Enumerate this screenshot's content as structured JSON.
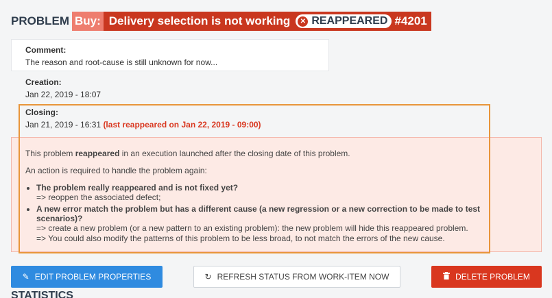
{
  "header": {
    "problem_word": "PROBLEM",
    "buy_tag": "Buy:",
    "title": "Delivery selection is not working",
    "status": "REAPPEARED",
    "ticket": "#4201"
  },
  "comment": {
    "label": "Comment:",
    "text": "The reason and root-cause is still unknown for now..."
  },
  "creation": {
    "label": "Creation:",
    "date": "Jan 22, 2019 - 18:07"
  },
  "closing": {
    "label": "Closing:",
    "date": "Jan 21, 2019 - 16:31",
    "reappeared": "(last reappeared on Jan 22, 2019 - 09:00)"
  },
  "warning": {
    "line1_prefix": "This problem ",
    "line1_bold": "reappeared",
    "line1_suffix": " in an execution launched after the closing date of this problem.",
    "line2": "An action is required to handle the problem again:",
    "item1_title": "The problem really reappeared and is not fixed yet?",
    "item1_sub": "=> reoppen the associated defect;",
    "item2_title": "A new error match the problem but has a different cause (a new regression or a new correction to be made to test scenarios)?",
    "item2_sub1": "=> create a new problem (or a new pattern to an existing problem): the new problem will hide this reappeared problem.",
    "item2_sub2": "=> You could also modify the patterns of this problem to be less broad, to not match the errors of the new cause."
  },
  "buttons": {
    "edit": "EDIT PROBLEM PROPERTIES",
    "refresh": "REFRESH STATUS FROM WORK-ITEM NOW",
    "delete": "DELETE PROBLEM"
  },
  "stats_title": "STATISTICS",
  "icons": {
    "status": "close-circle-icon",
    "edit": "pencil-icon",
    "refresh": "refresh-icon",
    "delete": "trash-icon"
  },
  "colors": {
    "accent_red": "#c9371f",
    "primary_blue": "#2f8be0",
    "highlight_orange": "#e8953a"
  }
}
